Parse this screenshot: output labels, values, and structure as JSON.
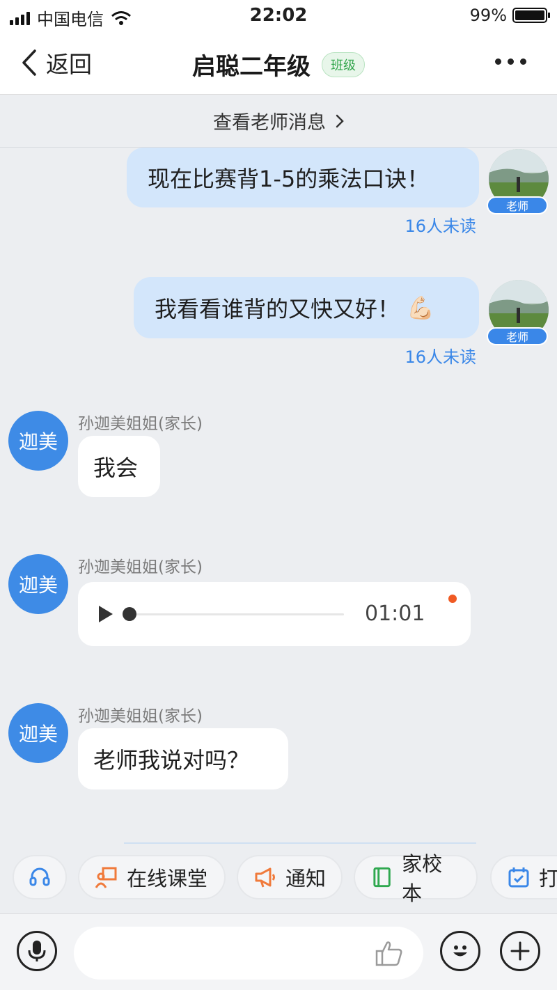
{
  "status_bar": {
    "carrier": "中国电信",
    "time": "22:02",
    "battery": "99%",
    "battery_level": 0.99
  },
  "nav": {
    "back_label": "返回",
    "title": "启聪二年级",
    "badge": "班级"
  },
  "teacher_link": {
    "label": "查看老师消息"
  },
  "messages": [
    {
      "direction": "out",
      "text": "现在比赛背1-5的乘法口诀！",
      "role_tag": "老师",
      "unread": "16人未读"
    },
    {
      "direction": "out",
      "text": "我看看谁背的又快又好！",
      "emoji": "💪🏻",
      "role_tag": "老师",
      "unread": "16人未读"
    },
    {
      "direction": "in",
      "avatar": "迦美",
      "sender": "孙迦美姐姐(家长)",
      "text": "我会"
    },
    {
      "direction": "in",
      "avatar": "迦美",
      "sender": "孙迦美姐姐(家长)",
      "type": "voice",
      "duration": "01:01",
      "progress": 0
    },
    {
      "direction": "in",
      "avatar": "迦美",
      "sender": "孙迦美姐姐(家长)",
      "text": "老师我说对吗？"
    }
  ],
  "quick_actions": [
    {
      "label": "",
      "icon": "headset-icon"
    },
    {
      "label": "在线课堂",
      "icon": "online-class-icon",
      "color": "#f07a3b"
    },
    {
      "label": "通知",
      "icon": "megaphone-icon",
      "color": "#f07a3b"
    },
    {
      "label": "家校本",
      "icon": "notebook-icon",
      "color": "#2fa84f"
    },
    {
      "label": "打",
      "icon": "calendar-check-icon",
      "color": "#3a87e8"
    }
  ],
  "input": {
    "value": "",
    "placeholder": ""
  },
  "colors": {
    "accent": "#3a87e8",
    "bubble_out": "#d3e6fb",
    "avatar_blue": "#3e8be6",
    "unread_dot": "#f05a23"
  }
}
